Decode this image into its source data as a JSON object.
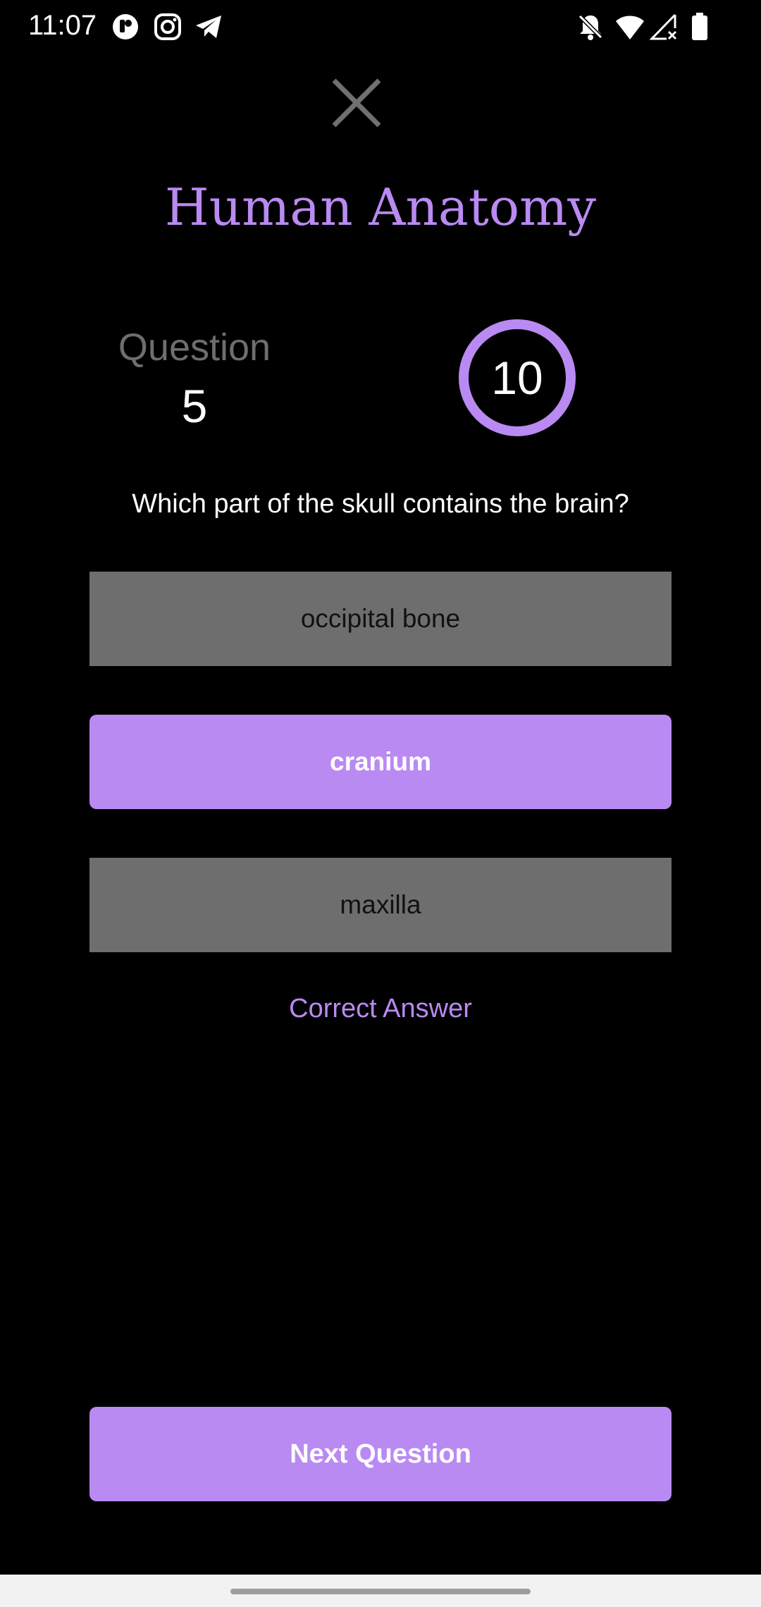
{
  "status_bar": {
    "time": "11:07",
    "left_icons": [
      "app-notification-icon",
      "instagram-icon",
      "telegram-icon"
    ],
    "right_icons": [
      "do-not-disturb-icon",
      "wifi-icon",
      "signal-icon",
      "battery-icon"
    ]
  },
  "header": {
    "close_icon": "close-icon",
    "title": "Human Anatomy"
  },
  "quiz": {
    "question_label": "Question",
    "question_number": "5",
    "timer": "10",
    "question_text": "Which part of the skull contains the brain?",
    "answers": [
      {
        "label": "occipital bone",
        "state": "unselected"
      },
      {
        "label": "cranium",
        "state": "selected"
      },
      {
        "label": "maxilla",
        "state": "unselected"
      }
    ],
    "feedback": "Correct Answer",
    "next_button": "Next Question"
  },
  "colors": {
    "accent": "#b98af2",
    "background": "#000000",
    "option_gray": "#6e6e6e"
  }
}
